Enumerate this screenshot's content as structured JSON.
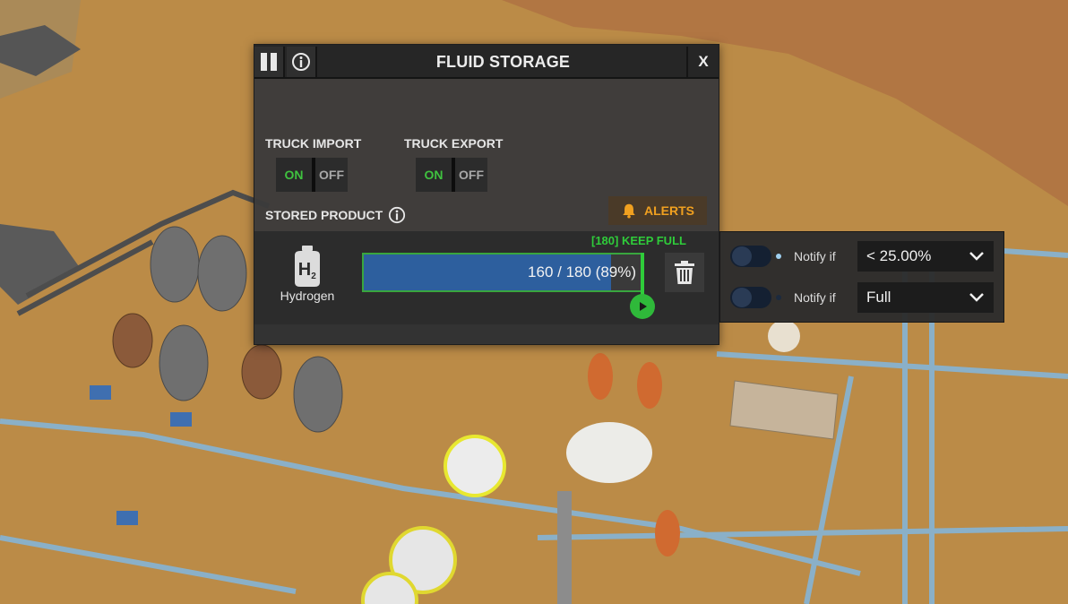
{
  "window": {
    "title": "FLUID STORAGE",
    "close_label": "X",
    "truck_import": {
      "label": "TRUCK IMPORT",
      "on_label": "ON",
      "off_label": "OFF"
    },
    "truck_export": {
      "label": "TRUCK EXPORT",
      "on_label": "ON",
      "off_label": "OFF"
    },
    "stored_product_label": "STORED PRODUCT",
    "alerts_label": "ALERTS",
    "product": {
      "name": "Hydrogen",
      "icon_text": "H",
      "icon_subscript": "2",
      "fill_text": "160 / 180 (89%)",
      "fill_fraction": 0.89,
      "keep_full_label": "[180] KEEP FULL"
    }
  },
  "alerts": [
    {
      "label": "Notify if",
      "value": "< 25.00%",
      "enabled": false
    },
    {
      "label": "Notify if",
      "value": "Full",
      "enabled": false
    }
  ],
  "colors": {
    "on_green": "#3fc23f",
    "alert_orange": "#f0a020",
    "bar_blue": "#2d5f9e",
    "keep_green": "#2fcc3a"
  }
}
